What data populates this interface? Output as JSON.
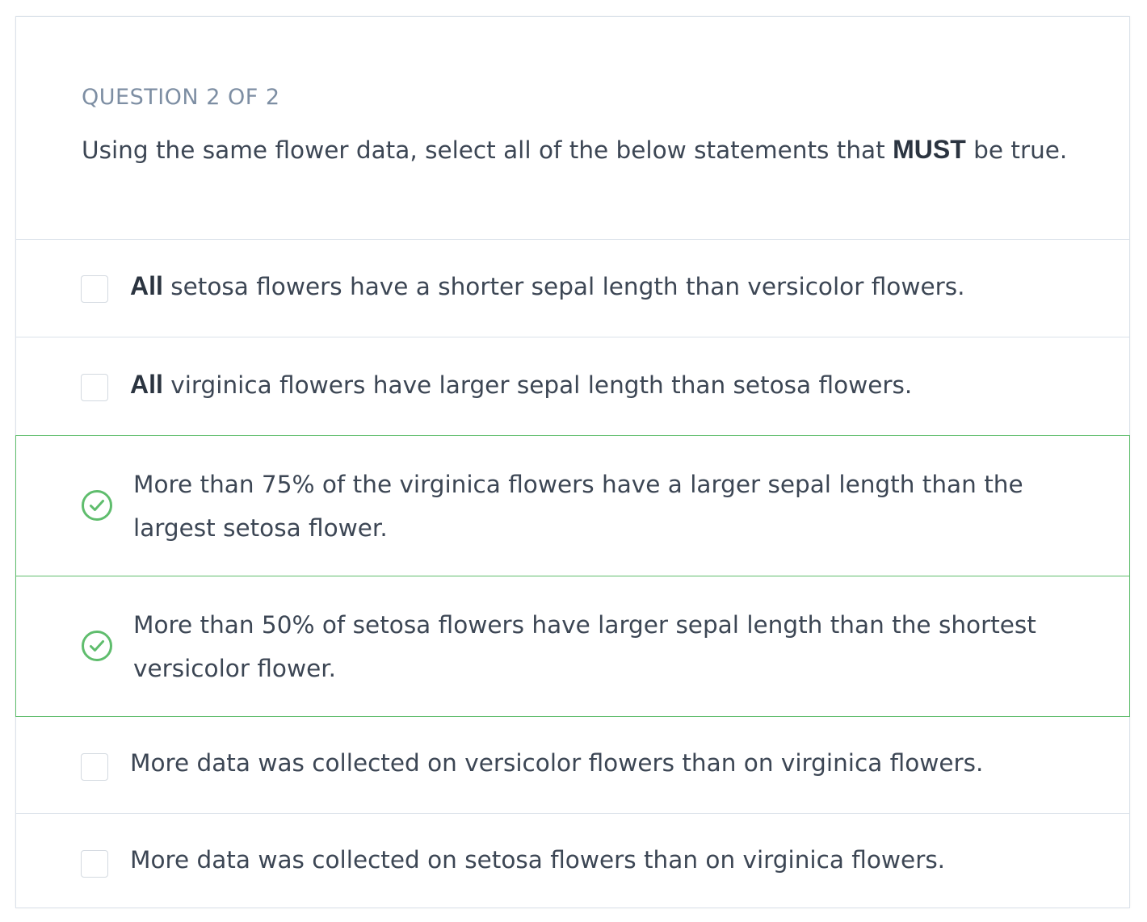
{
  "question": {
    "number_label": "QUESTION 2 OF 2",
    "text_before": "Using the same flower data, select all of the below statements that ",
    "text_bold": "MUST",
    "text_after": " be true."
  },
  "options": [
    {
      "bold": "All",
      "text": " setosa flowers have a shorter sepal length than versicolor flowers.",
      "state": "unchecked"
    },
    {
      "bold": "All",
      "text": " virginica flowers have larger sepal length than setosa flowers.",
      "state": "unchecked"
    },
    {
      "text": "More than 75% of the virginica flowers have a larger sepal length than the largest setosa flower.",
      "state": "correct"
    },
    {
      "text": "More than 50% of setosa flowers have larger sepal length than the shortest versicolor flower.",
      "state": "correct"
    },
    {
      "text": "More data was collected on versicolor flowers than on virginica flowers.",
      "state": "unchecked"
    },
    {
      "text": "More data was collected on setosa flowers than on virginica flowers.",
      "state": "unchecked"
    }
  ],
  "icons": {
    "correct": "check-circle-icon",
    "unchecked": "checkbox-icon"
  },
  "colors": {
    "correct": "#5fbd6d",
    "text": "#3c4654",
    "label": "#7d8ea3",
    "border": "#dbe2ea"
  }
}
